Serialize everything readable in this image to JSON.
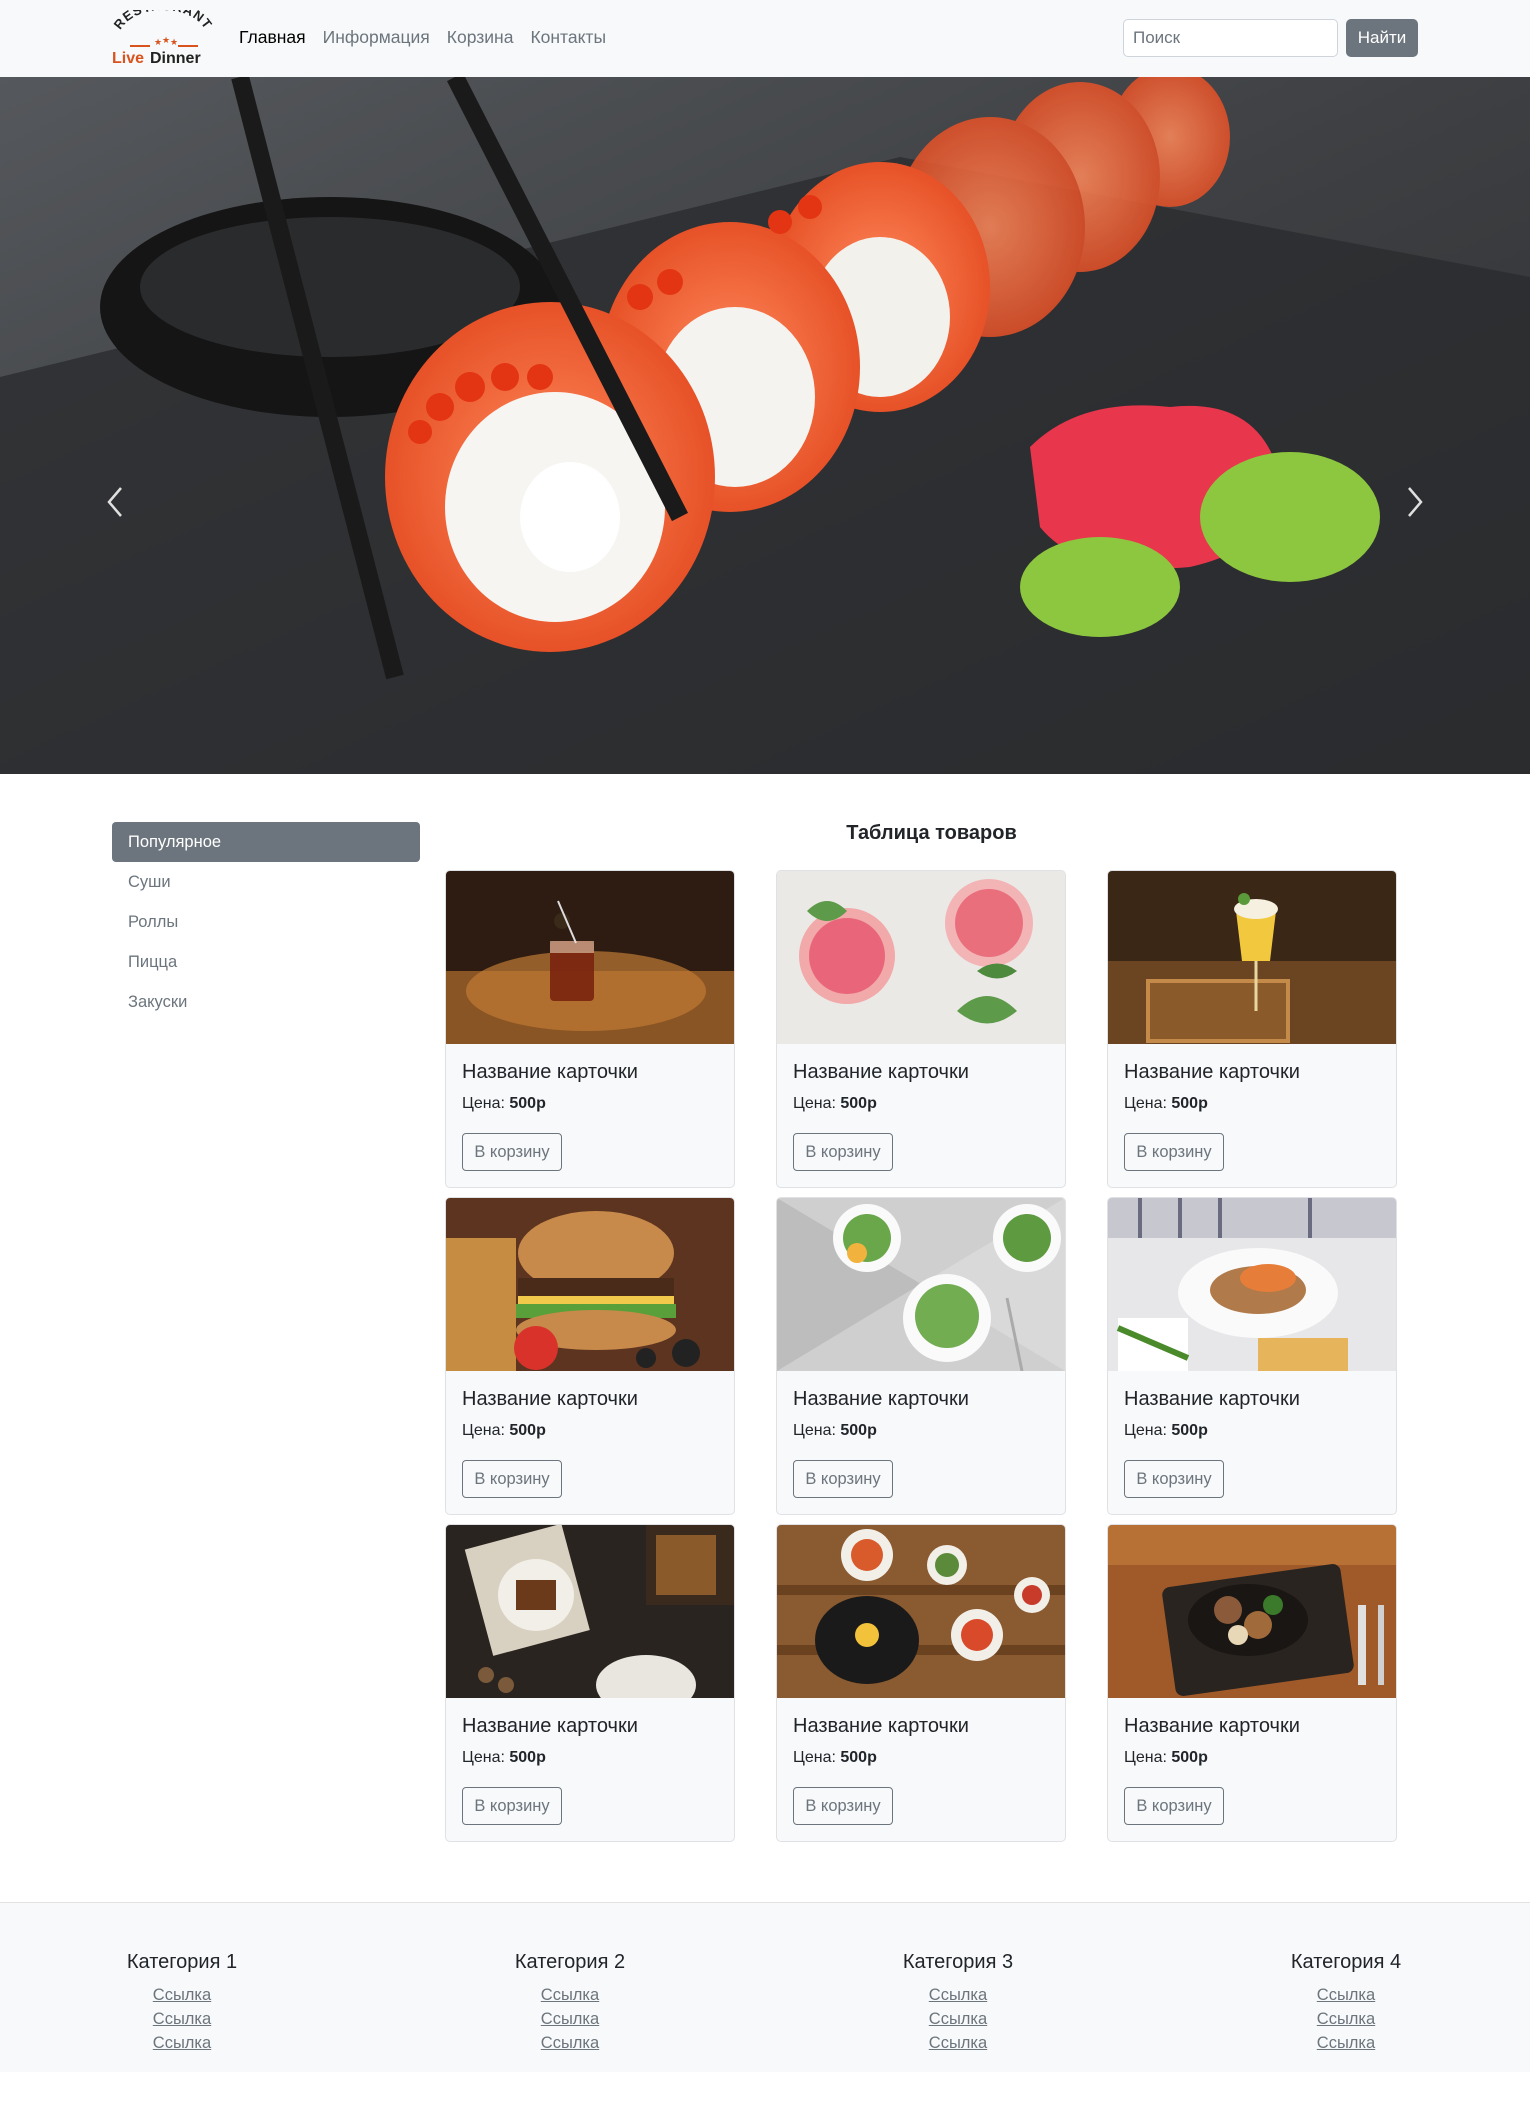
{
  "navbar": {
    "logo_top": "RESTAURANT",
    "logo_bottom": "Live Dinner",
    "links": [
      {
        "label": "Главная",
        "active": true
      },
      {
        "label": "Информация",
        "active": false
      },
      {
        "label": "Корзина",
        "active": false
      },
      {
        "label": "Контакты",
        "active": false
      }
    ],
    "search_placeholder": "Поиск",
    "search_button": "Найти"
  },
  "sidebar": {
    "items": [
      {
        "label": "Популярное",
        "active": true
      },
      {
        "label": "Суши",
        "active": false
      },
      {
        "label": "Роллы",
        "active": false
      },
      {
        "label": "Пицца",
        "active": false
      },
      {
        "label": "Закуски",
        "active": false
      }
    ]
  },
  "products": {
    "title": "Таблица товаров",
    "price_label": "Цена:",
    "cards": [
      {
        "title": "Название карточки",
        "price": "500р",
        "button": "В корзину",
        "image": "cocktail-dark"
      },
      {
        "title": "Название карточки",
        "price": "500р",
        "button": "В корзину",
        "image": "pink-drinks"
      },
      {
        "title": "Название карточки",
        "price": "500р",
        "button": "В корзину",
        "image": "yellow-cocktail"
      },
      {
        "title": "Название карточки",
        "price": "500р",
        "button": "В корзину",
        "image": "burger"
      },
      {
        "title": "Название карточки",
        "price": "500р",
        "button": "В корзину",
        "image": "salads"
      },
      {
        "title": "Название карточки",
        "price": "500р",
        "button": "В корзину",
        "image": "salmon-plate"
      },
      {
        "title": "Название карточки",
        "price": "500р",
        "button": "В корзину",
        "image": "dinner-table"
      },
      {
        "title": "Название карточки",
        "price": "500р",
        "button": "В корзину",
        "image": "korean-dishes"
      },
      {
        "title": "Название карточки",
        "price": "500р",
        "button": "В корзину",
        "image": "sizzling-plate"
      }
    ]
  },
  "footer": {
    "columns": [
      {
        "heading": "Категория 1",
        "links": [
          "Ссылка",
          "Ссылка",
          "Ссылка"
        ]
      },
      {
        "heading": "Категория 2",
        "links": [
          "Ссылка",
          "Ссылка",
          "Ссылка"
        ]
      },
      {
        "heading": "Категория 3",
        "links": [
          "Ссылка",
          "Ссылка",
          "Ссылка"
        ]
      },
      {
        "heading": "Категория 4",
        "links": [
          "Ссылка",
          "Ссылка",
          "Ссылка"
        ]
      }
    ]
  },
  "colors": {
    "navbar_bg": "#f8f9fa",
    "secondary": "#6c757d",
    "logo_accent": "#d9531e"
  }
}
